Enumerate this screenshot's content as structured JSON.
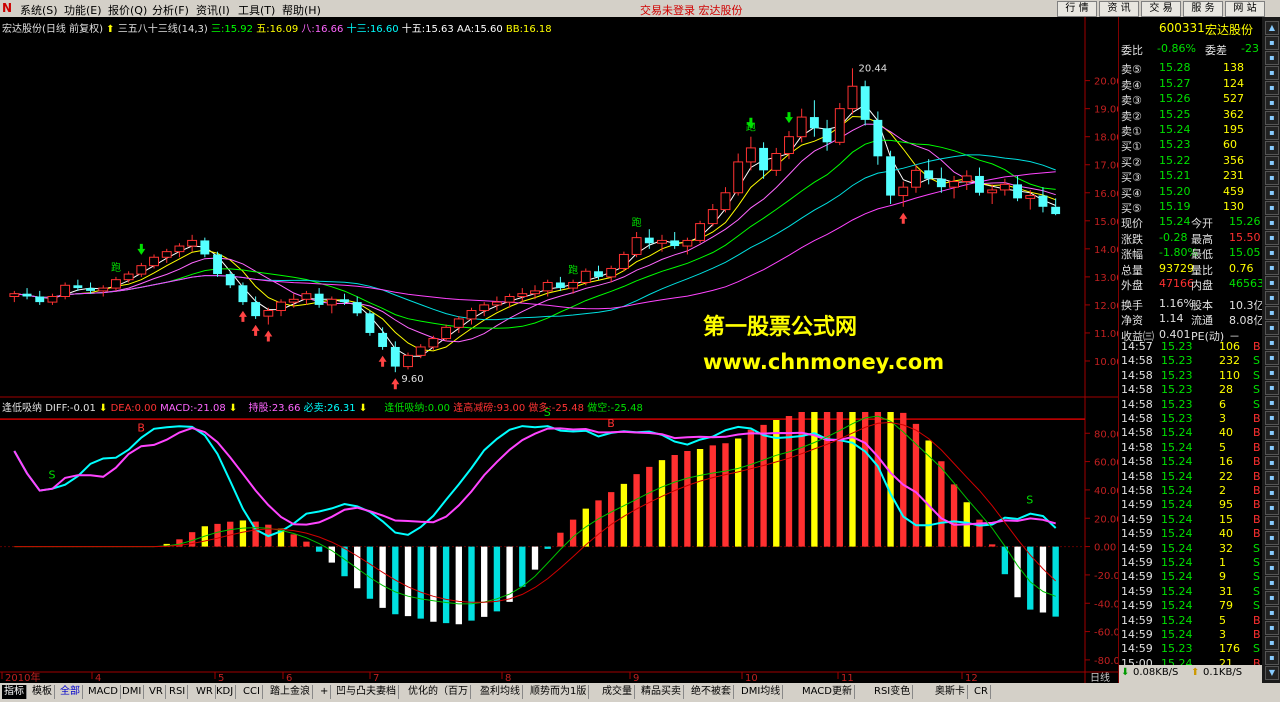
{
  "menu": {
    "items": [
      "系统(S)",
      "功能(E)",
      "报价(Q)",
      "分析(F)",
      "资讯(I)",
      "工具(T)",
      "帮助(H)"
    ],
    "notice": "交易未登录 宏达股份",
    "right_buttons": [
      "行 情",
      "资 讯",
      "交 易",
      "服 务",
      "网 站"
    ]
  },
  "chart": {
    "main_legend": {
      "title": "宏达股份(日线 前复权)",
      "ind": "三五八十三线(14,3)",
      "v3": "三:15.92",
      "v5": "五:16.09",
      "v8": "八:16.66",
      "v13": "十三:16.60",
      "v15": "十五:15.63",
      "aa": "AA:15.60",
      "bb": "BB:16.18"
    },
    "sub_legend": {
      "name": "逢低吸纳",
      "diff": "DIFF:-0.01",
      "dea": "DEA:0.00",
      "macd": "MACD:-21.08",
      "chicang": "持股:23.66",
      "bimai": "必卖:26.31",
      "fdxn": "逢低吸纳:0.00",
      "fgjm": "逢高减磅:93.00",
      "zd": "做多:-25.48",
      "zk": "做空:-25.48"
    },
    "high_label": "20.44",
    "low_label": "9.60",
    "watermark1": "第一股票公式网",
    "watermark2": "www.chnmoney.com",
    "main_axis": [
      "20.00",
      "19.00",
      "18.00",
      "17.00",
      "16.00",
      "15.00",
      "14.00",
      "13.00",
      "12.00",
      "11.00",
      "10.00"
    ],
    "sub_axis": [
      "80.00",
      "60.00",
      "40.00",
      "20.00",
      "0.00",
      "-20.00",
      "-40.00",
      "-60.00",
      "-80.00"
    ],
    "x_labels": [
      "2010年",
      "4",
      "5",
      "6",
      "7",
      "8",
      "9",
      "10",
      "11",
      "12"
    ],
    "period_label": "日线",
    "signal_pao": "跑",
    "signal_b": "B",
    "signal_s": "S"
  },
  "chart_data": {
    "type": "candlestick",
    "title": "宏达股份(日线 前复权)",
    "ylim": [
      9.5,
      20.7
    ],
    "candles": [
      [
        12.3,
        12.5,
        12.1,
        12.4
      ],
      [
        12.4,
        12.6,
        12.2,
        12.3
      ],
      [
        12.3,
        12.5,
        12.0,
        12.1
      ],
      [
        12.1,
        12.4,
        12.0,
        12.3
      ],
      [
        12.3,
        12.8,
        12.2,
        12.7
      ],
      [
        12.7,
        12.9,
        12.5,
        12.6
      ],
      [
        12.6,
        12.8,
        12.4,
        12.5
      ],
      [
        12.5,
        12.7,
        12.3,
        12.6
      ],
      [
        12.6,
        13.0,
        12.5,
        12.9
      ],
      [
        12.9,
        13.2,
        12.8,
        13.1
      ],
      [
        13.1,
        13.5,
        13.0,
        13.4
      ],
      [
        13.4,
        13.8,
        13.3,
        13.7
      ],
      [
        13.7,
        14.0,
        13.5,
        13.9
      ],
      [
        13.9,
        14.2,
        13.7,
        14.1
      ],
      [
        14.1,
        14.5,
        13.9,
        14.3
      ],
      [
        14.3,
        14.4,
        13.7,
        13.8
      ],
      [
        13.8,
        13.9,
        13.0,
        13.1
      ],
      [
        13.1,
        13.2,
        12.6,
        12.7
      ],
      [
        12.7,
        12.8,
        12.0,
        12.1
      ],
      [
        12.1,
        12.3,
        11.5,
        11.6
      ],
      [
        11.6,
        11.9,
        11.3,
        11.8
      ],
      [
        11.8,
        12.2,
        11.6,
        12.1
      ],
      [
        12.1,
        12.4,
        11.9,
        12.2
      ],
      [
        12.2,
        12.5,
        12.0,
        12.4
      ],
      [
        12.4,
        12.6,
        11.9,
        12.0
      ],
      [
        12.0,
        12.3,
        11.7,
        12.2
      ],
      [
        12.2,
        12.4,
        12.0,
        12.1
      ],
      [
        12.1,
        12.3,
        11.6,
        11.7
      ],
      [
        11.7,
        11.8,
        10.9,
        11.0
      ],
      [
        11.0,
        11.2,
        10.4,
        10.5
      ],
      [
        10.5,
        10.7,
        9.6,
        9.8
      ],
      [
        9.8,
        10.3,
        9.7,
        10.2
      ],
      [
        10.2,
        10.6,
        10.1,
        10.5
      ],
      [
        10.5,
        10.9,
        10.4,
        10.8
      ],
      [
        10.8,
        11.3,
        10.7,
        11.2
      ],
      [
        11.2,
        11.6,
        11.0,
        11.5
      ],
      [
        11.5,
        11.9,
        11.3,
        11.8
      ],
      [
        11.8,
        12.1,
        11.6,
        12.0
      ],
      [
        12.0,
        12.3,
        11.8,
        12.1
      ],
      [
        12.1,
        12.4,
        11.9,
        12.3
      ],
      [
        12.3,
        12.6,
        12.1,
        12.4
      ],
      [
        12.4,
        12.7,
        12.2,
        12.5
      ],
      [
        12.5,
        12.9,
        12.3,
        12.8
      ],
      [
        12.8,
        13.0,
        12.5,
        12.6
      ],
      [
        12.6,
        12.9,
        12.4,
        12.8
      ],
      [
        12.8,
        13.3,
        12.7,
        13.2
      ],
      [
        13.2,
        13.4,
        12.9,
        13.0
      ],
      [
        13.0,
        13.4,
        12.8,
        13.3
      ],
      [
        13.3,
        13.9,
        13.2,
        13.8
      ],
      [
        13.8,
        14.6,
        13.7,
        14.4
      ],
      [
        14.4,
        14.7,
        14.0,
        14.2
      ],
      [
        14.2,
        14.5,
        13.9,
        14.3
      ],
      [
        14.3,
        14.6,
        14.0,
        14.1
      ],
      [
        14.1,
        14.4,
        13.8,
        14.3
      ],
      [
        14.3,
        15.0,
        14.2,
        14.9
      ],
      [
        14.9,
        15.6,
        14.8,
        15.4
      ],
      [
        15.4,
        16.2,
        15.3,
        16.0
      ],
      [
        16.0,
        17.4,
        15.9,
        17.1
      ],
      [
        17.1,
        18.0,
        16.8,
        17.6
      ],
      [
        17.6,
        17.8,
        16.5,
        16.8
      ],
      [
        16.8,
        17.6,
        16.6,
        17.4
      ],
      [
        17.4,
        18.2,
        17.2,
        18.0
      ],
      [
        18.0,
        19.0,
        17.8,
        18.7
      ],
      [
        18.7,
        19.3,
        18.0,
        18.3
      ],
      [
        18.3,
        18.6,
        17.5,
        17.8
      ],
      [
        17.8,
        19.2,
        17.7,
        19.0
      ],
      [
        19.0,
        20.44,
        18.8,
        19.8
      ],
      [
        19.8,
        20.0,
        18.4,
        18.6
      ],
      [
        18.6,
        18.9,
        17.0,
        17.3
      ],
      [
        17.3,
        17.5,
        15.6,
        15.9
      ],
      [
        15.9,
        16.4,
        15.5,
        16.2
      ],
      [
        16.2,
        17.0,
        16.0,
        16.8
      ],
      [
        16.8,
        17.2,
        16.3,
        16.5
      ],
      [
        16.5,
        16.9,
        16.0,
        16.2
      ],
      [
        16.2,
        16.6,
        15.8,
        16.4
      ],
      [
        16.4,
        16.8,
        16.1,
        16.6
      ],
      [
        16.6,
        16.9,
        15.9,
        16.0
      ],
      [
        16.0,
        16.3,
        15.6,
        16.1
      ],
      [
        16.1,
        16.5,
        15.9,
        16.3
      ],
      [
        16.3,
        16.6,
        15.7,
        15.8
      ],
      [
        15.8,
        16.1,
        15.4,
        15.9
      ],
      [
        15.9,
        16.2,
        15.3,
        15.5
      ],
      [
        15.5,
        15.8,
        15.2,
        15.24
      ]
    ],
    "sub_oscillator": "逢低吸纳",
    "sub_ylim": [
      -85,
      95
    ]
  },
  "panel": {
    "code": "600331",
    "name": "宏达股份",
    "wb_label": "委比",
    "wb": "-0.86%",
    "wc_label": "委差",
    "wc": "-23",
    "sells": [
      [
        "卖⑤",
        "15.28",
        "138"
      ],
      [
        "卖④",
        "15.27",
        "124"
      ],
      [
        "卖③",
        "15.26",
        "527"
      ],
      [
        "卖②",
        "15.25",
        "362"
      ],
      [
        "卖①",
        "15.24",
        "195"
      ]
    ],
    "buys": [
      [
        "买①",
        "15.23",
        "60"
      ],
      [
        "买②",
        "15.22",
        "356"
      ],
      [
        "买③",
        "15.21",
        "231"
      ],
      [
        "买④",
        "15.20",
        "459"
      ],
      [
        "买⑤",
        "15.19",
        "130"
      ]
    ],
    "stats": [
      [
        "现价",
        "15.24",
        "今开",
        "15.26"
      ],
      [
        "涨跌",
        "-0.28",
        "最高",
        "15.50"
      ],
      [
        "涨幅",
        "-1.80%",
        "最低",
        "15.05"
      ],
      [
        "总量",
        "93729",
        "量比",
        "0.76"
      ],
      [
        "外盘",
        "47166",
        "内盘",
        "46563"
      ],
      [
        "换手",
        "1.16%",
        "股本",
        "10.3亿"
      ],
      [
        "净资",
        "1.14",
        "流通",
        "8.08亿"
      ],
      [
        "收益㈢",
        "0.401",
        "PE(动)",
        "－"
      ]
    ],
    "ticks": [
      [
        "14:57",
        "15.23",
        "106",
        "B"
      ],
      [
        "14:58",
        "15.23",
        "232",
        "S"
      ],
      [
        "14:58",
        "15.23",
        "110",
        "S"
      ],
      [
        "14:58",
        "15.23",
        "28",
        "S"
      ],
      [
        "14:58",
        "15.23",
        "6",
        "S"
      ],
      [
        "14:58",
        "15.23",
        "3",
        "B"
      ],
      [
        "14:58",
        "15.24",
        "40",
        "B"
      ],
      [
        "14:58",
        "15.24",
        "5",
        "B"
      ],
      [
        "14:58",
        "15.24",
        "16",
        "B"
      ],
      [
        "14:58",
        "15.24",
        "22",
        "B"
      ],
      [
        "14:58",
        "15.24",
        "2",
        "B"
      ],
      [
        "14:59",
        "15.24",
        "95",
        "B"
      ],
      [
        "14:59",
        "15.24",
        "15",
        "B"
      ],
      [
        "14:59",
        "15.24",
        "40",
        "B"
      ],
      [
        "14:59",
        "15.24",
        "32",
        "S"
      ],
      [
        "14:59",
        "15.24",
        "1",
        "S"
      ],
      [
        "14:59",
        "15.24",
        "9",
        "S"
      ],
      [
        "14:59",
        "15.24",
        "31",
        "S"
      ],
      [
        "14:59",
        "15.24",
        "79",
        "S"
      ],
      [
        "14:59",
        "15.24",
        "5",
        "B"
      ],
      [
        "14:59",
        "15.24",
        "3",
        "B"
      ],
      [
        "14:59",
        "15.23",
        "176",
        "S"
      ],
      [
        "15:00",
        "15.24",
        "21",
        "B"
      ]
    ],
    "net_down": "0.08KB/S",
    "net_up": "0.1KB/S",
    "footer_tabs": [
      "笔",
      "价",
      "细",
      "盘",
      "势",
      "联"
    ]
  },
  "bottom_tabs": [
    "指标",
    "模板",
    "全部",
    "MACD",
    "DMI",
    "VR",
    "RSI",
    "WR",
    "KDJ",
    "CCI",
    "踏上金浪",
    "+",
    "凹与凸夫妻档",
    "优化的（百万",
    "盈利均线",
    "顺势而为1版",
    "成交量",
    "精品买卖",
    "绝不被套",
    "DMI均线",
    "MACD更新",
    "RSI变色",
    "奥斯卡",
    "CR"
  ]
}
